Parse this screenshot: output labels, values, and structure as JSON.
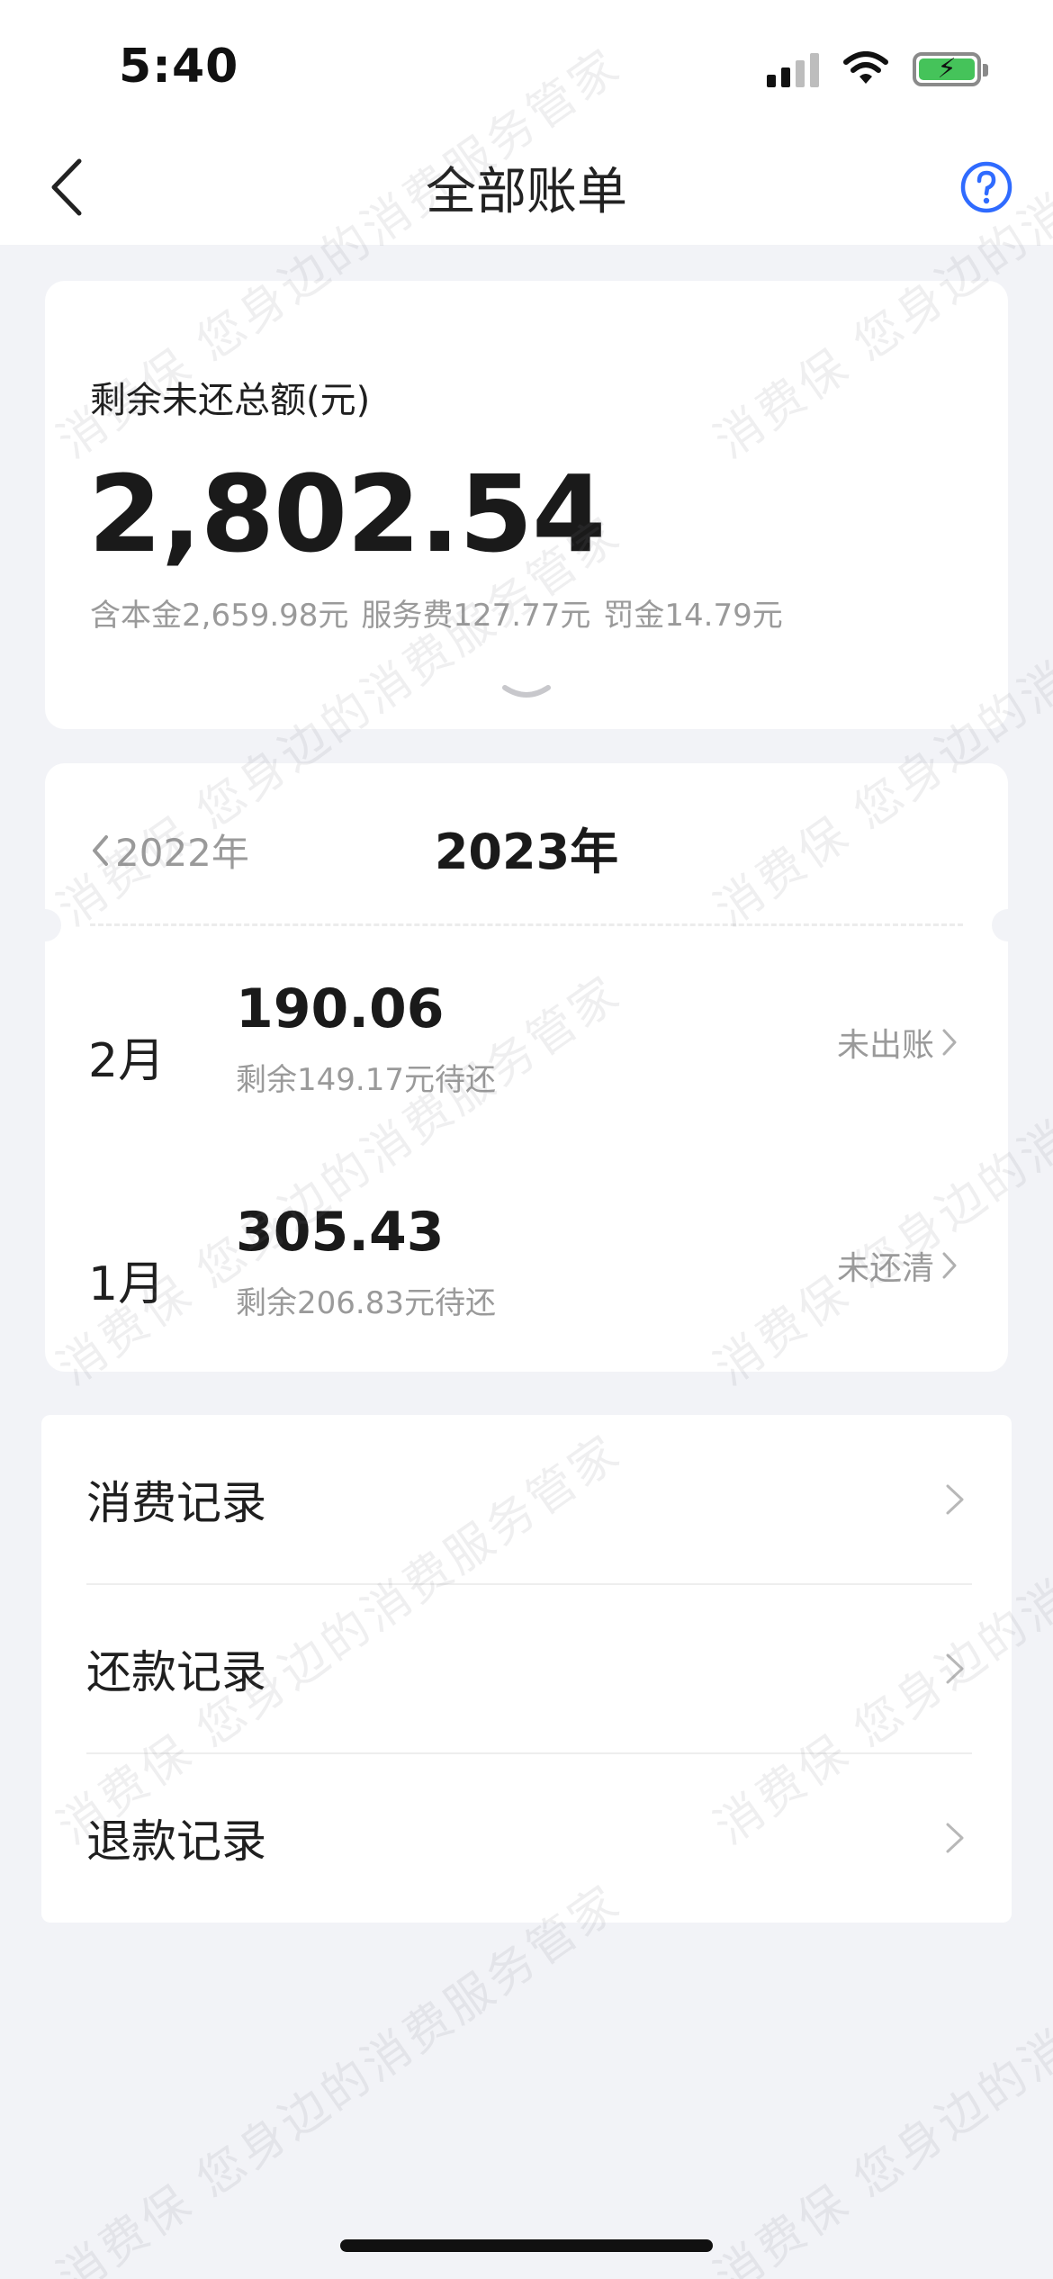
{
  "status_bar": {
    "time": "5:40"
  },
  "nav": {
    "title": "全部账单"
  },
  "summary": {
    "label": "剩余未还总额(元)",
    "amount": "2,802.54",
    "principal": "含本金2,659.98元",
    "service_fee": "服务费127.77元",
    "penalty": "罚金14.79元"
  },
  "bills": {
    "prev_year": "2022年",
    "current_year": "2023年",
    "items": [
      {
        "month": "2月",
        "amount": "190.06",
        "remaining": "剩余149.17元待还",
        "status": "未出账"
      },
      {
        "month": "1月",
        "amount": "305.43",
        "remaining": "剩余206.83元待还",
        "status": "未还清"
      }
    ]
  },
  "records": {
    "items": [
      {
        "label": "消费记录"
      },
      {
        "label": "还款记录"
      },
      {
        "label": "退款记录"
      }
    ]
  },
  "watermark": {
    "text": "消费保 您身边的消费服务管家"
  },
  "colors": {
    "accent": "#2f6bff",
    "battery": "#45c35a"
  }
}
